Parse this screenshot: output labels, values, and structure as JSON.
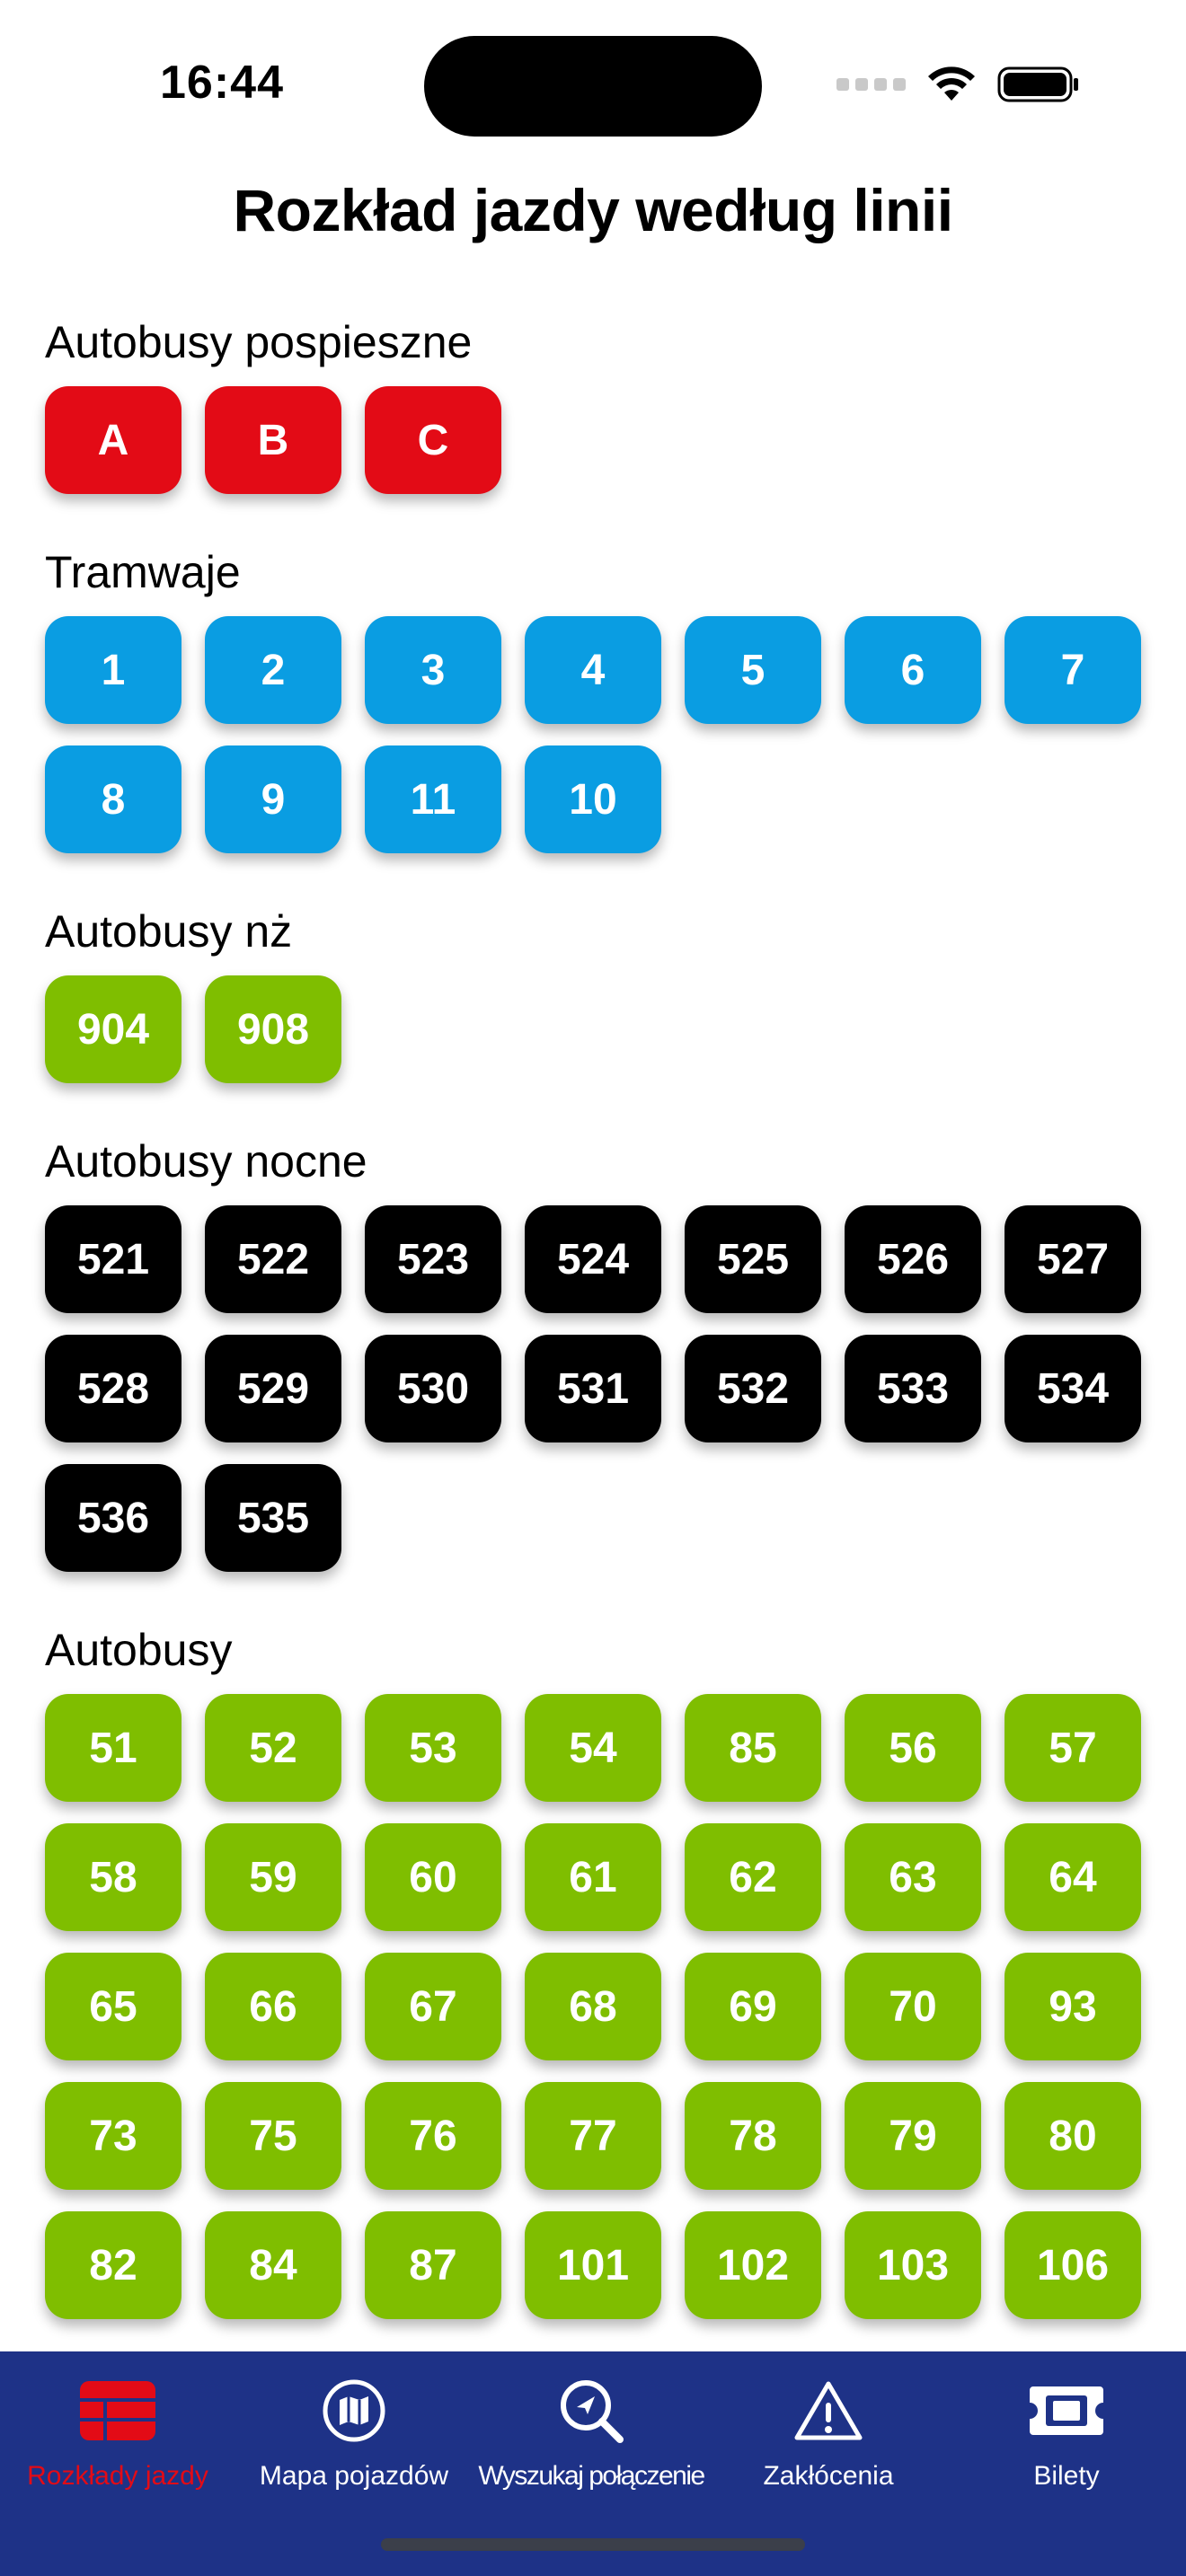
{
  "status_bar": {
    "time": "16:44"
  },
  "page_title": "Rozkład jazdy według linii",
  "colors": {
    "express": "#e30b16",
    "tram": "#0a9de2",
    "bus": "#7fbe00",
    "night": "#000000",
    "tabbar": "#1e3287",
    "tab_active": "#e30b16"
  },
  "sections": [
    {
      "title": "Autobusy pospieszne",
      "color": "#e30b16",
      "lines": [
        "A",
        "B",
        "C"
      ]
    },
    {
      "title": "Tramwaje",
      "color": "#0a9de2",
      "lines": [
        "1",
        "2",
        "3",
        "4",
        "5",
        "6",
        "7",
        "8",
        "9",
        "11",
        "10"
      ]
    },
    {
      "title": "Autobusy nż",
      "color": "#7fbe00",
      "lines": [
        "904",
        "908"
      ]
    },
    {
      "title": "Autobusy nocne",
      "color": "#000000",
      "lines": [
        "521",
        "522",
        "523",
        "524",
        "525",
        "526",
        "527",
        "528",
        "529",
        "530",
        "531",
        "532",
        "533",
        "534",
        "536",
        "535"
      ]
    },
    {
      "title": "Autobusy",
      "color": "#7fbe00",
      "lines": [
        "51",
        "52",
        "53",
        "54",
        "85",
        "56",
        "57",
        "58",
        "59",
        "60",
        "61",
        "62",
        "63",
        "64",
        "65",
        "66",
        "67",
        "68",
        "69",
        "70",
        "93",
        "73",
        "75",
        "76",
        "77",
        "78",
        "79",
        "80",
        "82",
        "84",
        "87",
        "101",
        "102",
        "103",
        "106"
      ]
    }
  ],
  "tabs": [
    {
      "label": "Rozkłady jazdy",
      "icon": "timetable-grid-icon",
      "active": true
    },
    {
      "label": "Mapa pojazdów",
      "icon": "map-icon",
      "active": false
    },
    {
      "label": "Wyszukaj połączenie",
      "icon": "search-route-icon",
      "active": false
    },
    {
      "label": "Zakłócenia",
      "icon": "warning-triangle-icon",
      "active": false
    },
    {
      "label": "Bilety",
      "icon": "ticket-icon",
      "active": false
    }
  ]
}
